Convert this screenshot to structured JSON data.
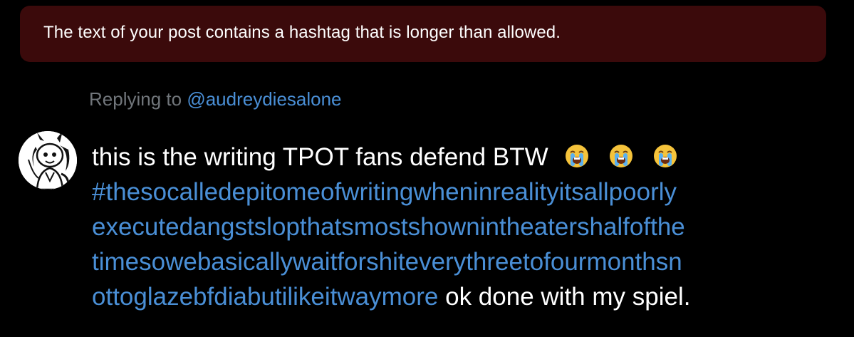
{
  "error_banner": {
    "message": "The text of your post contains a hashtag that is longer than allowed."
  },
  "reply_context": {
    "prefix": "Replying to ",
    "mention": "@audreydiesalone"
  },
  "post": {
    "text_start": "this is the writing TPOT fans defend BTW",
    "emojis": [
      "loudly-crying-face-emoji",
      "loudly-crying-face-emoji",
      "loudly-crying-face-emoji"
    ],
    "hashtag_lines": [
      "#thesocalledepitomeofwritingwheninrealityitsallpoorly",
      "executedangstslopthatsmostshownintheatershalfofthe",
      "timesowebasicallywaitforshiteverythreetofourmonthsn",
      "ottoglazebfdiabutilikeitwaymore"
    ],
    "text_end": " ok done with my spiel."
  },
  "colors": {
    "background": "#000000",
    "error_banner_bg": "#3b0a0b",
    "link": "#4a8fd6",
    "muted": "#71767b",
    "text": "#ffffff"
  }
}
